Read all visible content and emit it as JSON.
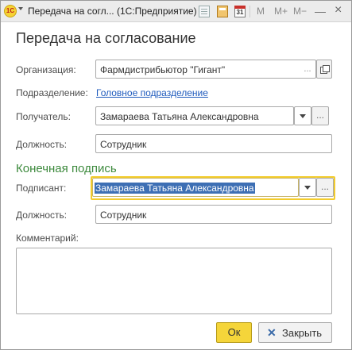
{
  "titlebar": {
    "app_logo": "1С",
    "title": "Передача на согл... (1С:Предприятие)",
    "calendar_day": "31",
    "m_label": "M",
    "m_plus_label": "M+",
    "m_minus_label": "M−",
    "minimize_glyph": "—",
    "close_glyph": "×"
  },
  "form": {
    "title": "Передача на согласование",
    "organization": {
      "label": "Организация:",
      "value": "Фармдистрибьютор \"Гигант\"",
      "choice_glyph": "...",
      "open_icon": "open-icon"
    },
    "department": {
      "label": "Подразделение:",
      "link": "Головное подразделение"
    },
    "recipient": {
      "label": "Получатель:",
      "value": "Замараева Татьяна Александровна",
      "choice_glyph": "..."
    },
    "recipient_position": {
      "label": "Должность:",
      "value": "Сотрудник"
    },
    "section_final_signature": "Конечная подпись",
    "signer": {
      "label": "Подписант:",
      "value": "Замараева Татьяна Александровна",
      "choice_glyph": "..."
    },
    "signer_position": {
      "label": "Должность:",
      "value": "Сотрудник"
    },
    "comment": {
      "label": "Комментарий:",
      "value": ""
    }
  },
  "buttons": {
    "ok": "Ок",
    "close": "Закрыть"
  },
  "colors": {
    "accent_yellow": "#f5d53a",
    "section_green": "#3d8a3d",
    "link_blue": "#1f5bbd",
    "selection_blue": "#3d6fb4"
  }
}
